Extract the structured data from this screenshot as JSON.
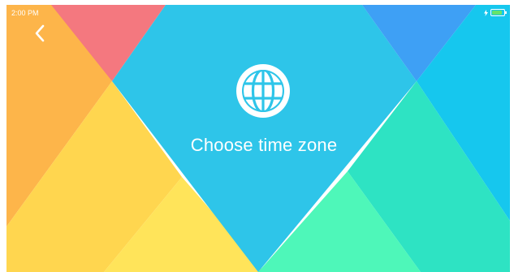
{
  "status_bar": {
    "time": "2:00 PM",
    "battery_level": 0.85,
    "charging_icon": "bolt-icon",
    "battery_icon": "battery-icon"
  },
  "navigation": {
    "back_icon": "chevron-left-icon"
  },
  "main": {
    "icon": "globe-icon",
    "title": "Choose time zone"
  },
  "colors": {
    "center_diamond": "#2ec5e9",
    "left_orange": "#fdb54a",
    "pink": "#f4787f",
    "yellow": "#ffd64f",
    "light_yellow": "#ffe45a",
    "blue": "#3ea0f5",
    "cyan": "#16c7ee",
    "teal": "#2ee3c3",
    "mint": "#4ef7b9"
  }
}
